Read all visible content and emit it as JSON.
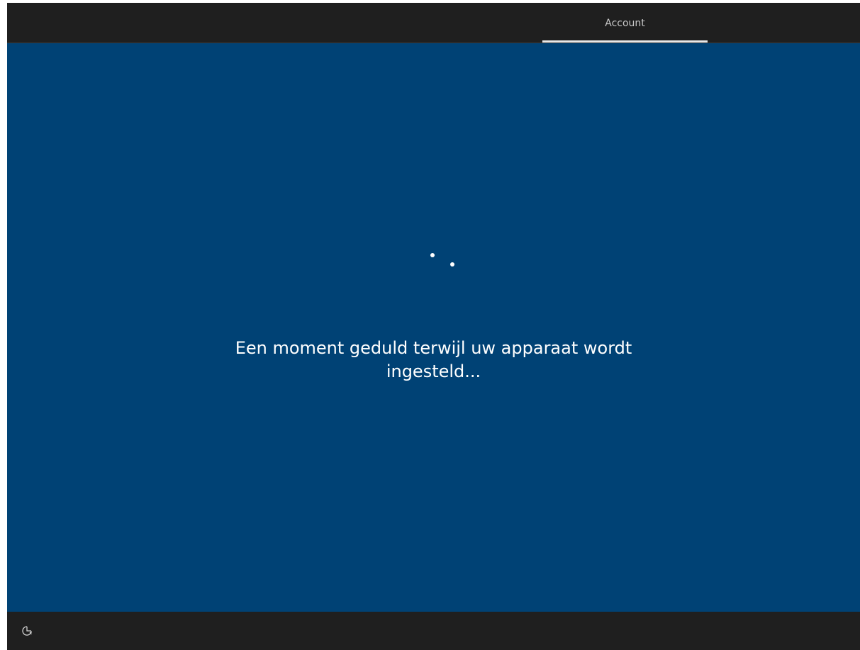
{
  "header": {
    "tabs": [
      {
        "label": "Account",
        "active": true
      }
    ]
  },
  "main": {
    "message": "Een moment geduld terwijl uw apparaat wordt ingesteld..."
  },
  "footer": {
    "accessibility_icon": "accessibility-icon"
  },
  "colors": {
    "background": "#004275",
    "chrome": "#1f1f1f",
    "text": "#ffffff",
    "tab_text": "#c8c8c8"
  }
}
